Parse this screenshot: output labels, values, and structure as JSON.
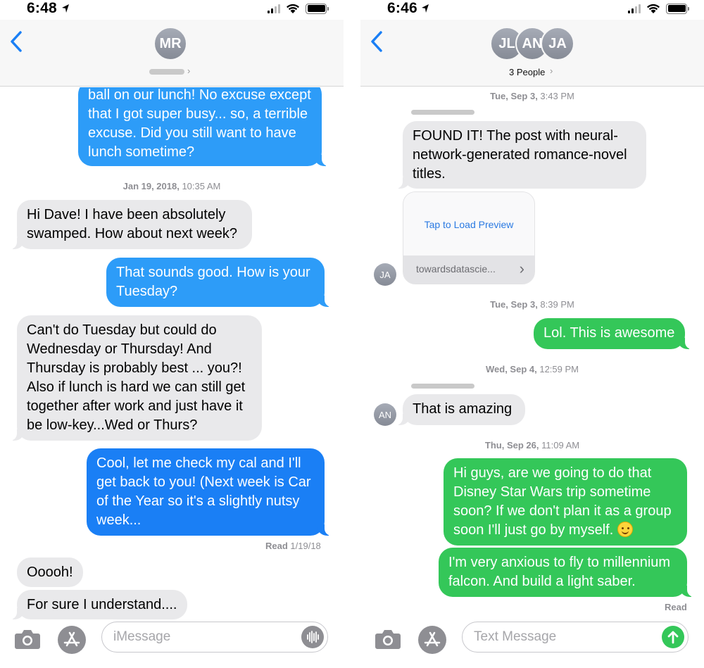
{
  "left": {
    "status_time": "6:48",
    "contact_initials": "MR",
    "messages": {
      "m1": "ball on our lunch! No excuse except that I got super busy... so, a terrible excuse. Did you still want to have lunch sometime?",
      "m2": "Hi Dave! I have been absolutely swamped. How about next week?",
      "m3": "That sounds good. How is your Tuesday?",
      "m4": "Can't do Tuesday but could do Wednesday or Thursday! And Thursday is probably best ... you?! Also if lunch is hard we can still get together after work and just have it be low-key...Wed or Thurs?",
      "m5": "Cool, let me check my cal and I'll get back to you! (Next week is Car of the Year so it's a slightly nutsy week...",
      "m6": "Ooooh!",
      "m7": "For sure I understand...."
    },
    "stamp1_date": "Jan 19, 2018,",
    "stamp1_time": " 10:35 AM",
    "read_label": "Read",
    "read_date": " 1/19/18",
    "input_placeholder": "iMessage"
  },
  "right": {
    "status_time": "6:46",
    "avatars": [
      "JL",
      "AN",
      "JA"
    ],
    "people_label": "3 People",
    "stamp1_day": "Tue, Sep 3,",
    "stamp1_time": " 3:43 PM",
    "m1": "FOUND IT! The post with neural-network-generated romance-novel titles.",
    "preview_tap": "Tap to Load Preview",
    "preview_url": "towardsdatascie...",
    "sender_ja": "JA",
    "stamp2_day": "Tue, Sep 3,",
    "stamp2_time": " 8:39 PM",
    "m2": "Lol. This is awesome",
    "stamp3_day": "Wed, Sep 4,",
    "stamp3_time": " 12:59 PM",
    "m3": "That is amazing",
    "sender_an": "AN",
    "stamp4_day": "Thu, Sep 26,",
    "stamp4_time": " 11:09 AM",
    "m4": "Hi guys, are we going to do that Disney Star Wars trip sometime soon? If we don't plan it as a group soon I'll just go by myself.",
    "m5": "I'm very anxious to fly to millennium falcon. And build a light saber.",
    "read_label": "Read",
    "input_placeholder": "Text Message"
  },
  "colors": {
    "imessage_blue": "#2d9cf8",
    "sms_green": "#34c759",
    "incoming_gray": "#e9e9eb",
    "ios_link_blue": "#1a7ff5"
  }
}
